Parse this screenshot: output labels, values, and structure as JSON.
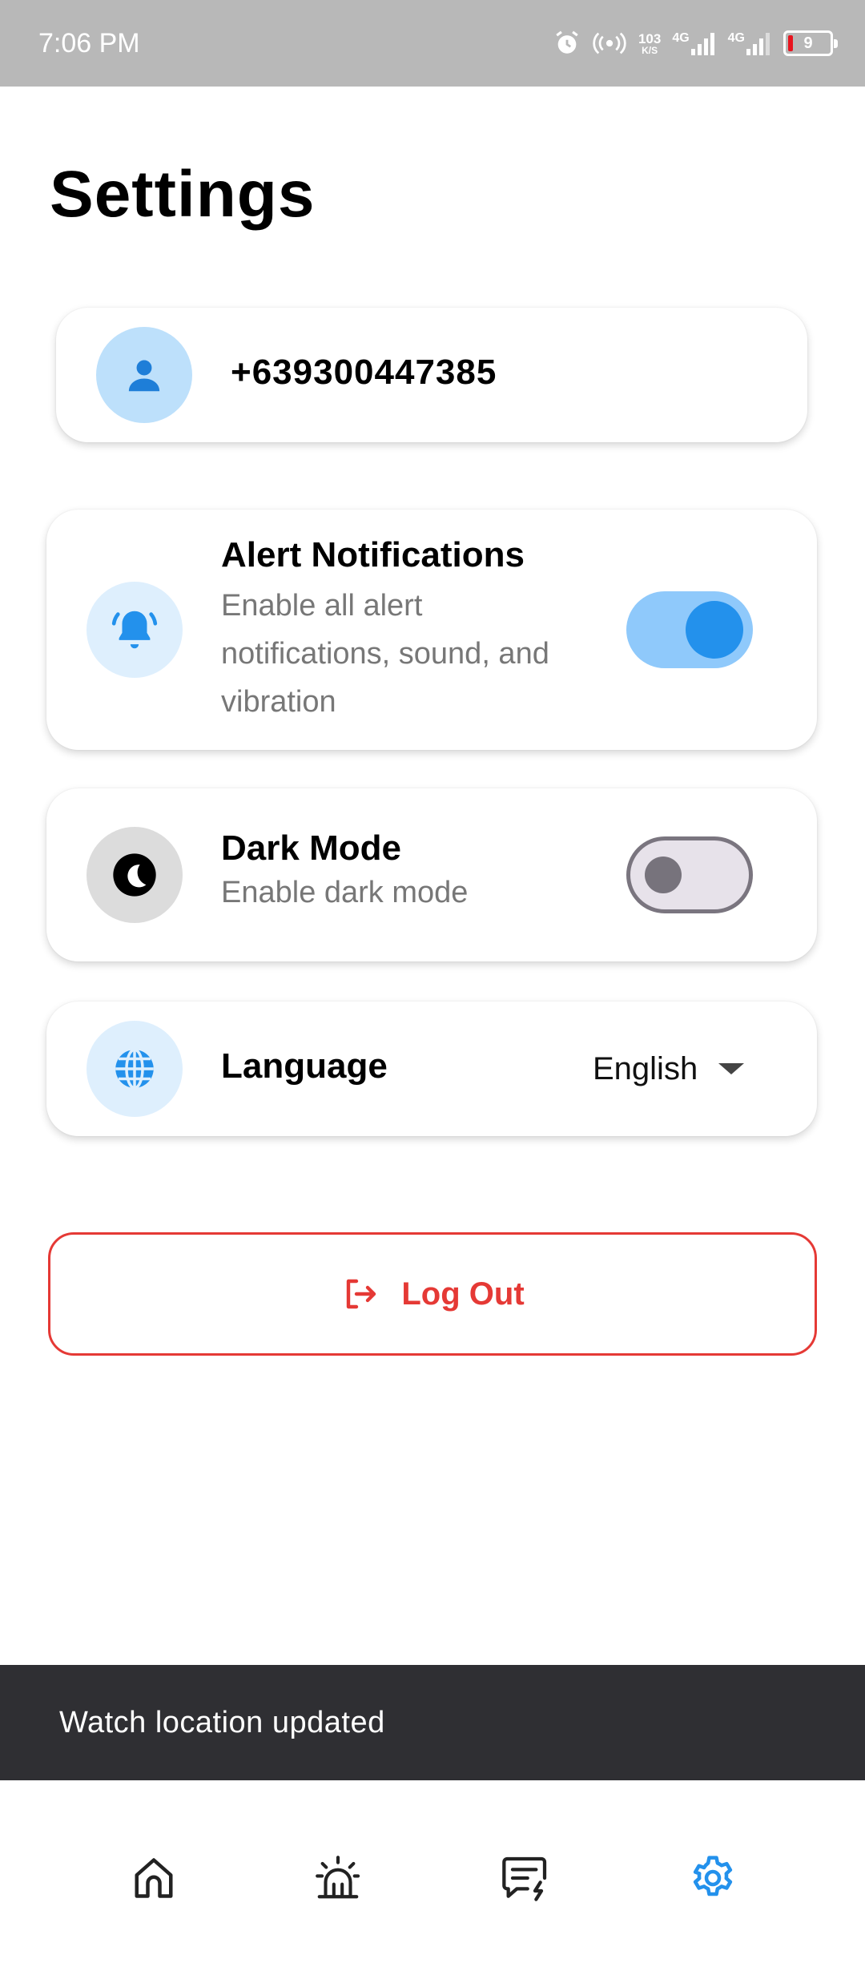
{
  "status_bar": {
    "time": "7:06 PM",
    "net_speed_value": "103",
    "net_speed_unit": "K/S",
    "net1_label": "4G",
    "net2_label": "4G",
    "battery_level": "9"
  },
  "page": {
    "title": "Settings"
  },
  "profile": {
    "phone": "+639300447385"
  },
  "alert_notifications": {
    "title": "Alert Notifications",
    "description": "Enable all alert notifications, sound, and vibration",
    "enabled": true
  },
  "dark_mode": {
    "title": "Dark Mode",
    "description": "Enable dark mode",
    "enabled": false
  },
  "language": {
    "title": "Language",
    "selected": "English"
  },
  "logout": {
    "label": "Log Out"
  },
  "snackbar": {
    "message": "Watch location updated"
  },
  "bottom_nav": {
    "items": [
      {
        "icon": "home-icon",
        "active": false
      },
      {
        "icon": "siren-icon",
        "active": false
      },
      {
        "icon": "message-alert-icon",
        "active": false
      },
      {
        "icon": "gear-icon",
        "active": true
      }
    ]
  },
  "colors": {
    "accent": "#2391ec",
    "danger": "#e53935",
    "status_bar": "#b8b8b8",
    "snackbar": "#2f2f33",
    "nav_inactive": "#222222"
  }
}
